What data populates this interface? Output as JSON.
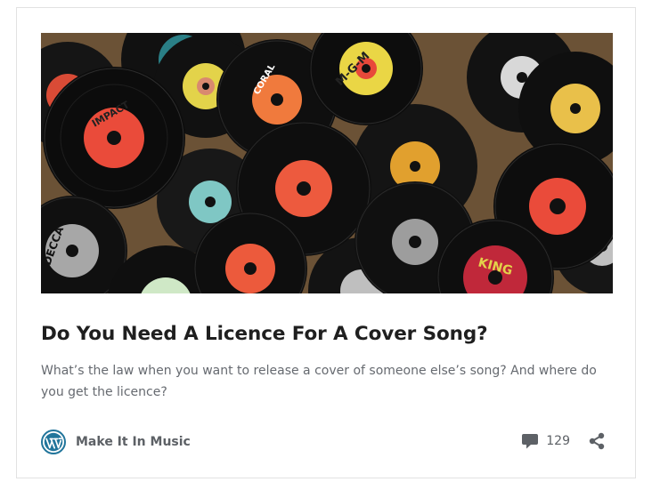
{
  "post": {
    "image_alt": "Pile of vintage 45 rpm vinyl records with colored labels",
    "title": "Do You Need A Licence For A Cover Song?",
    "excerpt": "What’s the law when you want to release a cover of someone else’s song? And where do you get the licence?"
  },
  "footer": {
    "site_name": "Make It In Music",
    "site_icon": "wordpress-icon",
    "comment_icon": "comment-bubble-icon",
    "comment_count": "129",
    "share_icon": "share-icon"
  },
  "record_labels": [
    "CORAL",
    "M-G-M",
    "IMPACT",
    "DECCA",
    "KING"
  ],
  "colors": {
    "title": "#1f1f1f",
    "text": "#666a70",
    "meta": "#5d6166",
    "wordpress_blue": "#21759b",
    "card_border": "#e2e2e2"
  }
}
